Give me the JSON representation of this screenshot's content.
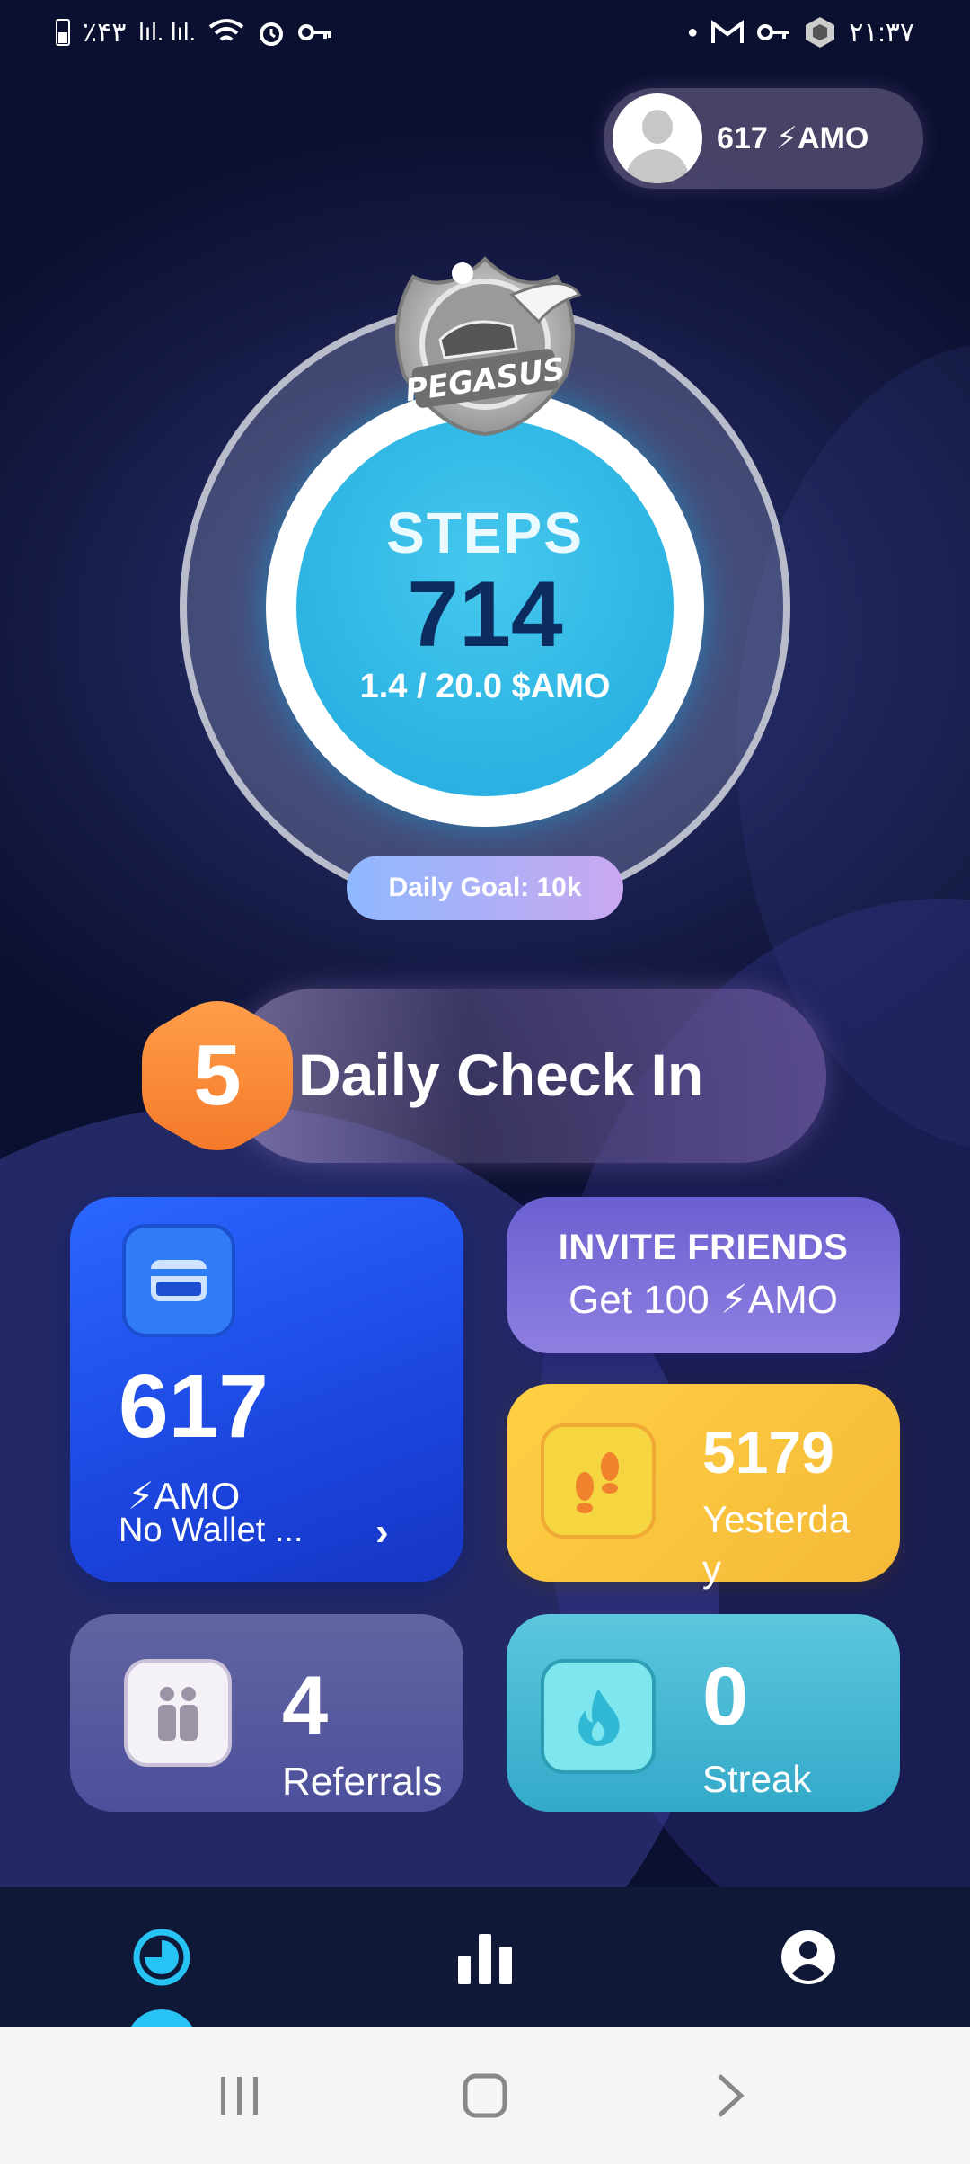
{
  "status_bar": {
    "battery_text": "٪۴۳",
    "signal_text": "lıl. lıl.",
    "time": "۲۱:۳۷"
  },
  "header": {
    "balance_label": "617 ⚡AMO"
  },
  "progress": {
    "badge_text": "PEGASUS",
    "label": "STEPS",
    "steps": "714",
    "reward": "1.4 / 20.0 $AMO",
    "daily_goal": "Daily Goal: 10k"
  },
  "checkin": {
    "number": "5",
    "label": "Daily Check In"
  },
  "wallet": {
    "amount": "617",
    "unit": "⚡AMO",
    "status": "No Wallet ...",
    "chevron": "›"
  },
  "invite": {
    "title": "INVITE FRIENDS",
    "subtitle": "Get 100 ⚡AMO"
  },
  "yesterday": {
    "value": "5179",
    "label": "Yesterday"
  },
  "referrals": {
    "value": "4",
    "label": "Referrals"
  },
  "streak": {
    "value": "0",
    "label": "Streak"
  },
  "colors": {
    "accent_cyan": "#27c3f5",
    "wallet_blue": "#1c46e0",
    "checkin_orange": "#ff8a3d",
    "steps_yellow": "#ffd044"
  }
}
